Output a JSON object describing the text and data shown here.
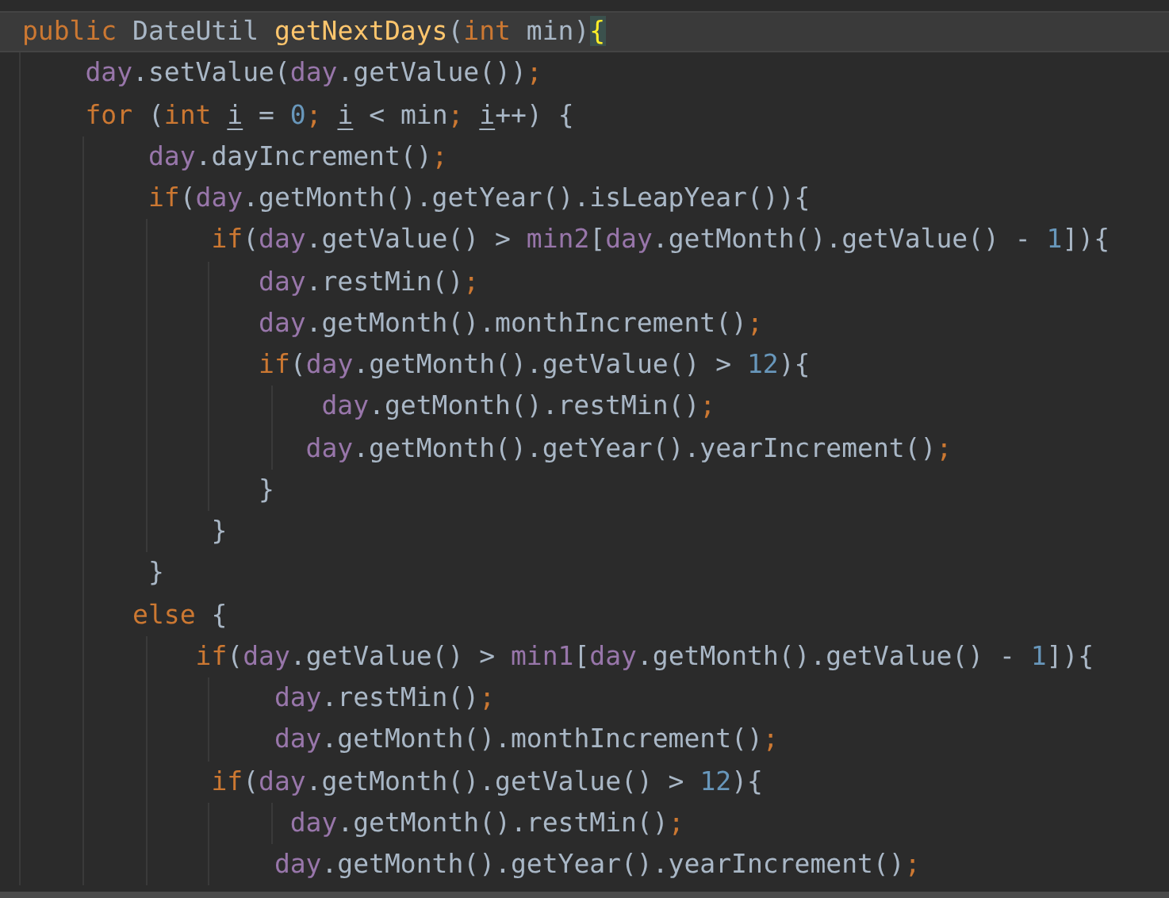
{
  "editor": {
    "lines": [
      {
        "current": true,
        "tokens": [
          {
            "text": "public ",
            "kind": "kw"
          },
          {
            "text": "DateUtil ",
            "kind": "plain"
          },
          {
            "text": "getNextDays",
            "kind": "decl"
          },
          {
            "text": "(",
            "kind": "plain"
          },
          {
            "text": "int ",
            "kind": "kw"
          },
          {
            "text": "min)",
            "kind": "plain"
          },
          {
            "text": "{",
            "kind": "brace-matched"
          }
        ]
      },
      {
        "current": false,
        "tokens": [
          {
            "text": "    day",
            "kind": "field"
          },
          {
            "text": ".setValue(",
            "kind": "plain"
          },
          {
            "text": "day",
            "kind": "field"
          },
          {
            "text": ".getValue())",
            "kind": "plain"
          },
          {
            "text": ";",
            "kind": "kw"
          }
        ]
      },
      {
        "current": false,
        "tokens": [
          {
            "text": "    for ",
            "kind": "kw"
          },
          {
            "text": "(",
            "kind": "plain"
          },
          {
            "text": "int ",
            "kind": "kw"
          },
          {
            "text": "i",
            "kind": "var-underlined"
          },
          {
            "text": " = ",
            "kind": "plain"
          },
          {
            "text": "0",
            "kind": "num"
          },
          {
            "text": "; ",
            "kind": "kw"
          },
          {
            "text": "i",
            "kind": "var-underlined"
          },
          {
            "text": " < min",
            "kind": "plain"
          },
          {
            "text": "; ",
            "kind": "kw"
          },
          {
            "text": "i",
            "kind": "var-underlined"
          },
          {
            "text": "++) {",
            "kind": "plain"
          }
        ]
      },
      {
        "current": false,
        "tokens": [
          {
            "text": "        day",
            "kind": "field"
          },
          {
            "text": ".dayIncrement()",
            "kind": "plain"
          },
          {
            "text": ";",
            "kind": "kw"
          }
        ]
      },
      {
        "current": false,
        "tokens": [
          {
            "text": "        if",
            "kind": "kw"
          },
          {
            "text": "(",
            "kind": "plain"
          },
          {
            "text": "day",
            "kind": "field"
          },
          {
            "text": ".getMonth().getYear().isLeapYear()){",
            "kind": "plain"
          }
        ]
      },
      {
        "current": false,
        "tokens": [
          {
            "text": "            if",
            "kind": "kw"
          },
          {
            "text": "(",
            "kind": "plain"
          },
          {
            "text": "day",
            "kind": "field"
          },
          {
            "text": ".getValue() > ",
            "kind": "plain"
          },
          {
            "text": "min2",
            "kind": "field"
          },
          {
            "text": "[",
            "kind": "plain"
          },
          {
            "text": "day",
            "kind": "field"
          },
          {
            "text": ".getMonth().getValue() - ",
            "kind": "plain"
          },
          {
            "text": "1",
            "kind": "num"
          },
          {
            "text": "]){",
            "kind": "plain"
          }
        ]
      },
      {
        "current": false,
        "tokens": [
          {
            "text": "               day",
            "kind": "field"
          },
          {
            "text": ".restMin()",
            "kind": "plain"
          },
          {
            "text": ";",
            "kind": "kw"
          }
        ]
      },
      {
        "current": false,
        "tokens": [
          {
            "text": "               day",
            "kind": "field"
          },
          {
            "text": ".getMonth().monthIncrement()",
            "kind": "plain"
          },
          {
            "text": ";",
            "kind": "kw"
          }
        ]
      },
      {
        "current": false,
        "tokens": [
          {
            "text": "               if",
            "kind": "kw"
          },
          {
            "text": "(",
            "kind": "plain"
          },
          {
            "text": "day",
            "kind": "field"
          },
          {
            "text": ".getMonth().getValue() > ",
            "kind": "plain"
          },
          {
            "text": "12",
            "kind": "num"
          },
          {
            "text": "){",
            "kind": "plain"
          }
        ]
      },
      {
        "current": false,
        "tokens": [
          {
            "text": "                   day",
            "kind": "field"
          },
          {
            "text": ".getMonth().restMin()",
            "kind": "plain"
          },
          {
            "text": ";",
            "kind": "kw"
          }
        ]
      },
      {
        "current": false,
        "tokens": [
          {
            "text": "                  day",
            "kind": "field"
          },
          {
            "text": ".getMonth().getYear().yearIncrement()",
            "kind": "plain"
          },
          {
            "text": ";",
            "kind": "kw"
          }
        ]
      },
      {
        "current": false,
        "tokens": [
          {
            "text": "               }",
            "kind": "plain"
          }
        ]
      },
      {
        "current": false,
        "tokens": [
          {
            "text": "            }",
            "kind": "plain"
          }
        ]
      },
      {
        "current": false,
        "tokens": [
          {
            "text": "        }",
            "kind": "plain"
          }
        ]
      },
      {
        "current": false,
        "tokens": [
          {
            "text": "       else ",
            "kind": "kw"
          },
          {
            "text": "{",
            "kind": "plain"
          }
        ]
      },
      {
        "current": false,
        "tokens": [
          {
            "text": "           if",
            "kind": "kw"
          },
          {
            "text": "(",
            "kind": "plain"
          },
          {
            "text": "day",
            "kind": "field"
          },
          {
            "text": ".getValue() > ",
            "kind": "plain"
          },
          {
            "text": "min1",
            "kind": "field"
          },
          {
            "text": "[",
            "kind": "plain"
          },
          {
            "text": "day",
            "kind": "field"
          },
          {
            "text": ".getMonth().getValue() - ",
            "kind": "plain"
          },
          {
            "text": "1",
            "kind": "num"
          },
          {
            "text": "]){",
            "kind": "plain"
          }
        ]
      },
      {
        "current": false,
        "tokens": [
          {
            "text": "                day",
            "kind": "field"
          },
          {
            "text": ".restMin()",
            "kind": "plain"
          },
          {
            "text": ";",
            "kind": "kw"
          }
        ]
      },
      {
        "current": false,
        "tokens": [
          {
            "text": "                day",
            "kind": "field"
          },
          {
            "text": ".getMonth().monthIncrement()",
            "kind": "plain"
          },
          {
            "text": ";",
            "kind": "kw"
          }
        ]
      },
      {
        "current": false,
        "tokens": [
          {
            "text": "            if",
            "kind": "kw"
          },
          {
            "text": "(",
            "kind": "plain"
          },
          {
            "text": "day",
            "kind": "field"
          },
          {
            "text": ".getMonth().getValue() > ",
            "kind": "plain"
          },
          {
            "text": "12",
            "kind": "num"
          },
          {
            "text": "){",
            "kind": "plain"
          }
        ]
      },
      {
        "current": false,
        "tokens": [
          {
            "text": "                 day",
            "kind": "field"
          },
          {
            "text": ".getMonth().restMin()",
            "kind": "plain"
          },
          {
            "text": ";",
            "kind": "kw"
          }
        ]
      },
      {
        "current": false,
        "tokens": [
          {
            "text": "                day",
            "kind": "field"
          },
          {
            "text": ".getMonth().getYear().yearIncrement()",
            "kind": "plain"
          },
          {
            "text": ";",
            "kind": "kw"
          }
        ]
      }
    ]
  }
}
